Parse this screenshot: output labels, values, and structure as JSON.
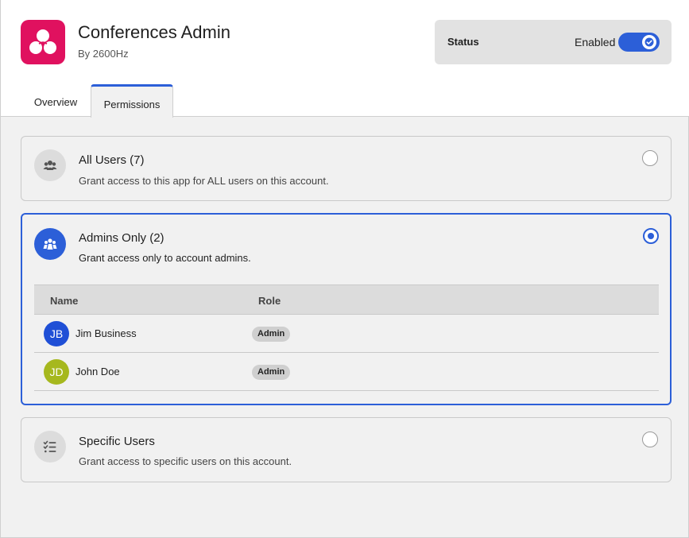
{
  "app": {
    "title": "Conferences Admin",
    "vendor": "By 2600Hz",
    "logo_icon": "conference-logo-icon",
    "brand_color": "#e0115f"
  },
  "status": {
    "label": "Status",
    "value": "Enabled",
    "enabled": true,
    "accent_color": "#2c5fd8"
  },
  "tabs": [
    {
      "label": "Overview",
      "active": false
    },
    {
      "label": "Permissions",
      "active": true
    }
  ],
  "permissions": {
    "options": [
      {
        "title": "All Users (7)",
        "description": "Grant access to this app for ALL users on this account.",
        "icon": "users-group-icon",
        "selected": false
      },
      {
        "title": "Admins Only (2)",
        "description": "Grant access only to account admins.",
        "icon": "admins-icon",
        "selected": true
      },
      {
        "title": "Specific Users",
        "description": "Grant access to specific users on this account.",
        "icon": "checklist-icon",
        "selected": false
      }
    ],
    "admins_table": {
      "columns": [
        "Name",
        "Role"
      ],
      "rows": [
        {
          "initials": "JB",
          "name": "Jim Business",
          "role": "Admin",
          "avatar_color": "#1f4fd6"
        },
        {
          "initials": "JD",
          "name": "John Doe",
          "role": "Admin",
          "avatar_color": "#a6b81e"
        }
      ]
    }
  }
}
